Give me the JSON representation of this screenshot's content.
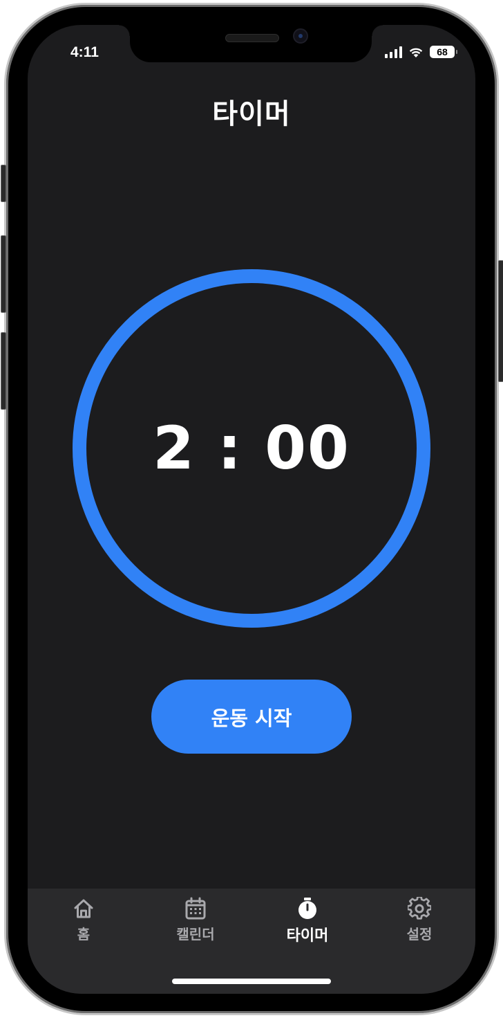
{
  "status_bar": {
    "time": "4:11",
    "battery": "68"
  },
  "header": {
    "title": "타이머"
  },
  "timer": {
    "display": "2 : 00",
    "progress": 1.0,
    "ring_color": "#3182f6"
  },
  "actions": {
    "start_label": "운동 시작"
  },
  "tab_bar": {
    "active": "타이머",
    "items": [
      {
        "label": "홈",
        "icon": "home-icon"
      },
      {
        "label": "캘린더",
        "icon": "calendar-icon"
      },
      {
        "label": "타이머",
        "icon": "stopwatch-icon"
      },
      {
        "label": "설정",
        "icon": "gear-icon"
      }
    ]
  },
  "colors": {
    "background": "#1c1c1e",
    "accent": "#3182f6",
    "tab_inactive": "#a9a9ad"
  }
}
